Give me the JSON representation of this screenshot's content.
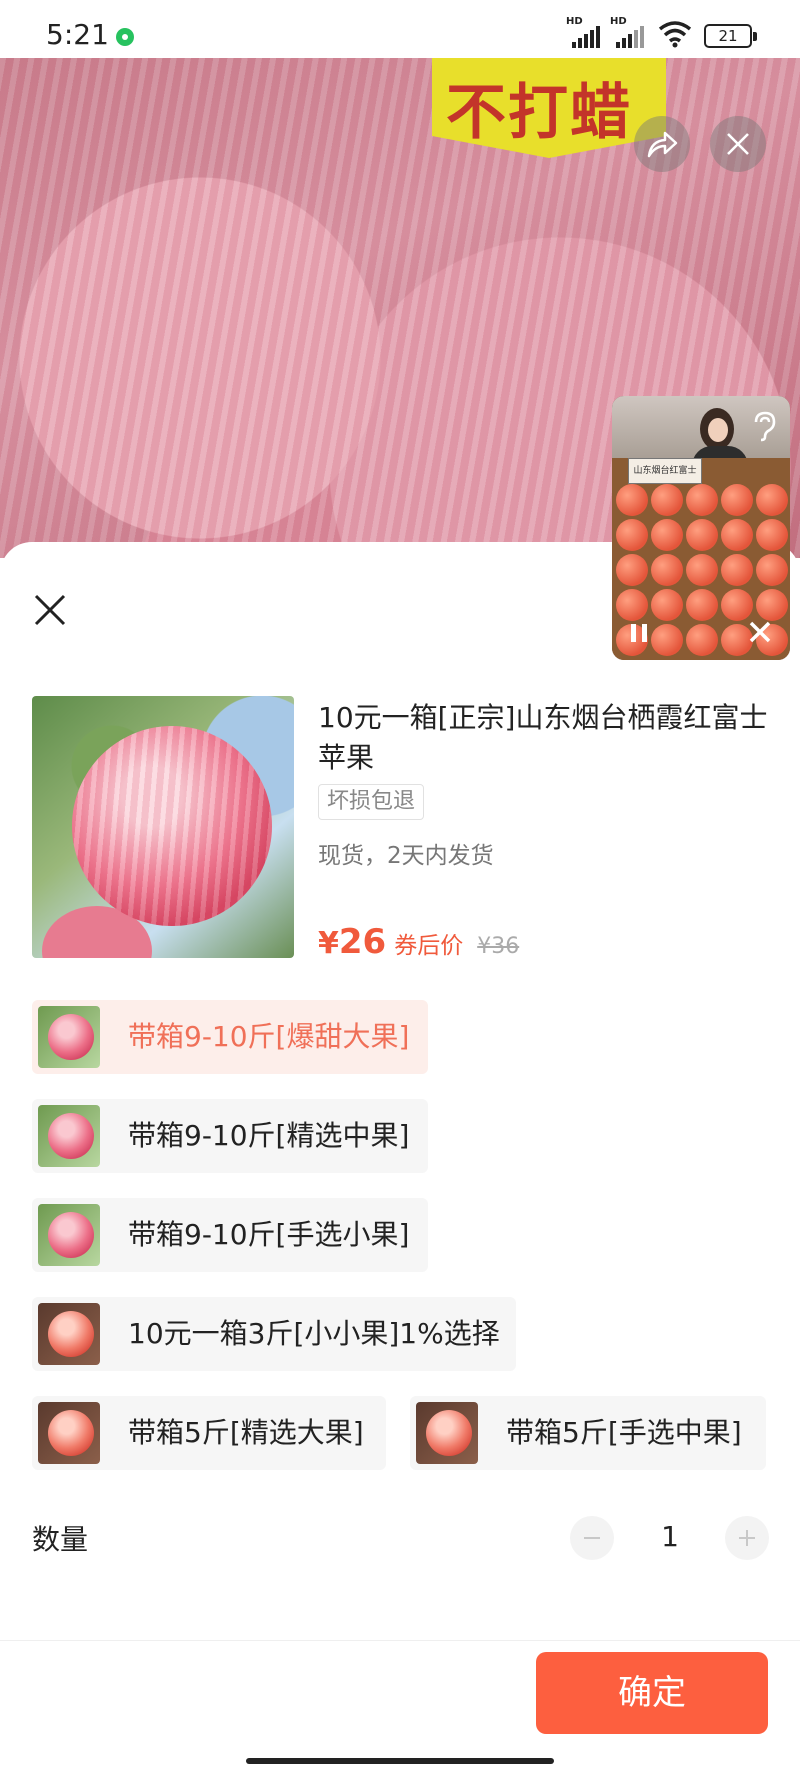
{
  "status_bar": {
    "time": "5:21",
    "battery": "21",
    "signal_labels": [
      "HD",
      "HD"
    ]
  },
  "hero": {
    "tag_text": "不打蜡"
  },
  "video": {
    "sign_text": "山东烟台红富士"
  },
  "product": {
    "title": "10元一箱[正宗]山东烟台栖霞红富士苹果",
    "tag": "坏损包退",
    "stock": "现货，2天内发货",
    "price_currency": "¥",
    "price_value": "26",
    "price_note": "券后价",
    "original_price": "¥36"
  },
  "options": [
    {
      "label": "带箱9-10斤[爆甜大果]",
      "selected": true
    },
    {
      "label": "带箱9-10斤[精选中果]",
      "selected": false
    },
    {
      "label": "带箱9-10斤[手选小果]",
      "selected": false
    },
    {
      "label": "10元一箱3斤[小小果]1%选择",
      "selected": false
    },
    {
      "label": "带箱5斤[精选大果]",
      "selected": false
    },
    {
      "label": "带箱5斤[手选中果]",
      "selected": false
    }
  ],
  "quantity": {
    "label": "数量",
    "value": "1"
  },
  "confirm_label": "确定",
  "colors": {
    "accent": "#fd5f3f",
    "price": "#f05a3c",
    "selected_bg": "#fdeeea"
  },
  "icons": [
    "share-icon",
    "close-icon",
    "ear-icon",
    "pause-icon",
    "minus-icon",
    "plus-icon",
    "wifi-icon"
  ]
}
